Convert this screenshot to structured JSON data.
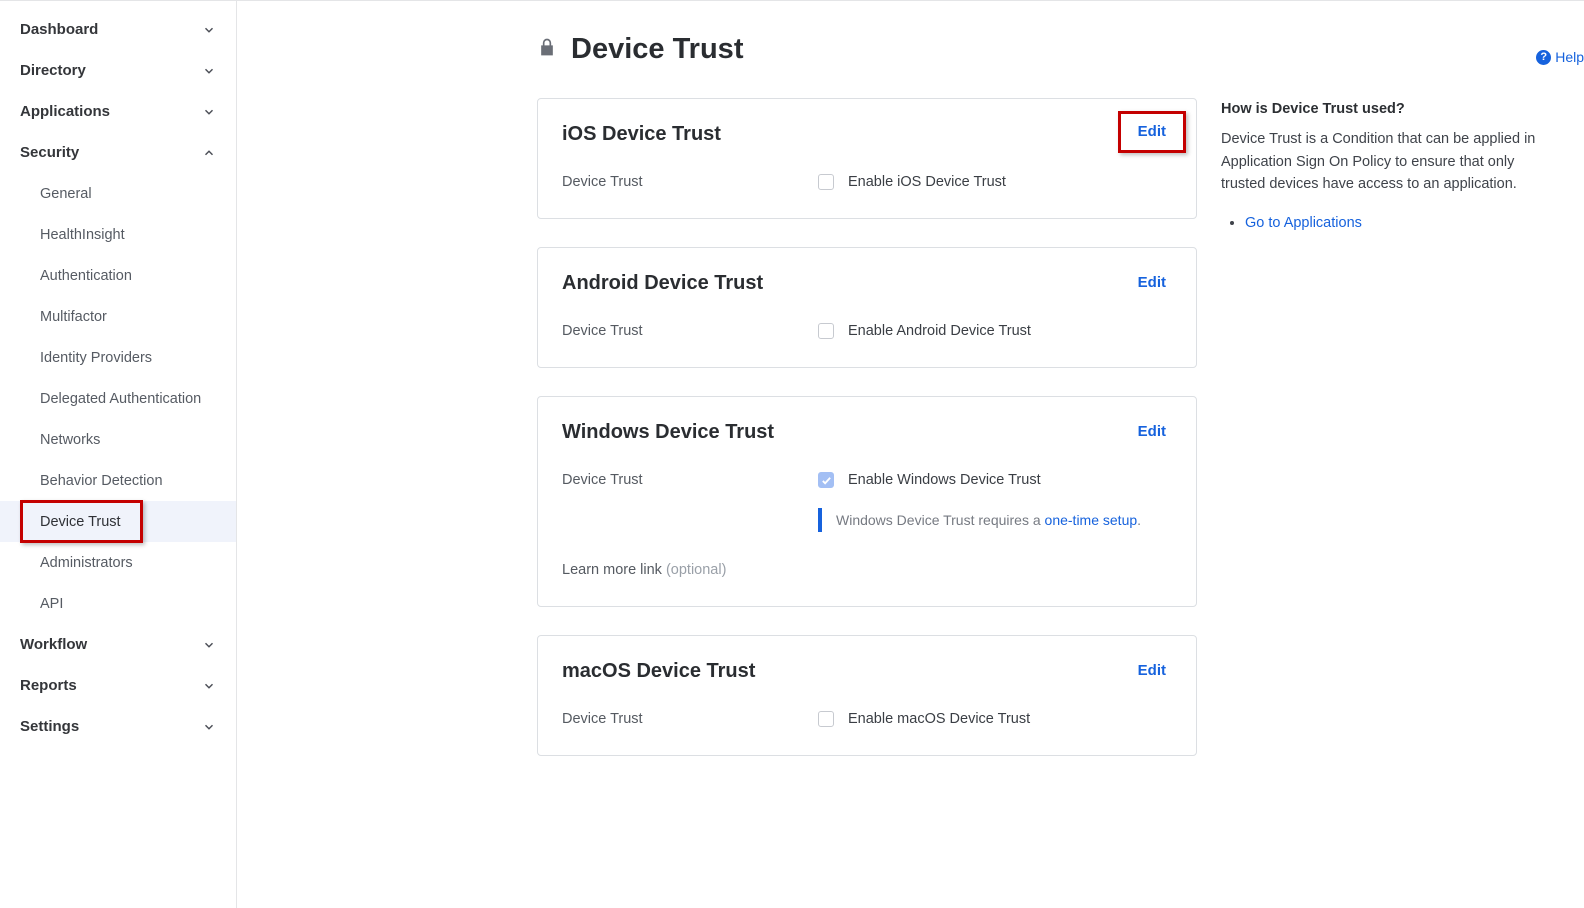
{
  "sidebar": {
    "dashboard": "Dashboard",
    "directory": "Directory",
    "applications": "Applications",
    "security": "Security",
    "workflow": "Workflow",
    "reports": "Reports",
    "settings": "Settings",
    "sec_items": {
      "general": "General",
      "healthinsight": "HealthInsight",
      "authentication": "Authentication",
      "multifactor": "Multifactor",
      "identity_providers": "Identity Providers",
      "delegated": "Delegated Authentication",
      "networks": "Networks",
      "behavior": "Behavior Detection",
      "device_trust": "Device Trust",
      "administrators": "Administrators",
      "api": "API"
    }
  },
  "page": {
    "title": "Device Trust",
    "help": "Help"
  },
  "aside": {
    "heading": "How is Device Trust used?",
    "body": "Device Trust is a Condition that can be applied in Application Sign On Policy to ensure that only trusted devices have access to an application.",
    "link": "Go to Applications"
  },
  "labels": {
    "device_trust": "Device Trust",
    "edit": "Edit",
    "learn_more": "Learn more link ",
    "optional": "(optional)"
  },
  "cards": {
    "ios": {
      "title": "iOS Device Trust",
      "checkbox": "Enable iOS Device Trust"
    },
    "android": {
      "title": "Android Device Trust",
      "checkbox": "Enable Android Device Trust"
    },
    "windows": {
      "title": "Windows Device Trust",
      "checkbox": "Enable Windows Device Trust",
      "note_prefix": "Windows Device Trust requires a ",
      "note_link": "one-time setup",
      "note_suffix": "."
    },
    "macos": {
      "title": "macOS Device Trust",
      "checkbox": "Enable macOS Device Trust"
    }
  }
}
